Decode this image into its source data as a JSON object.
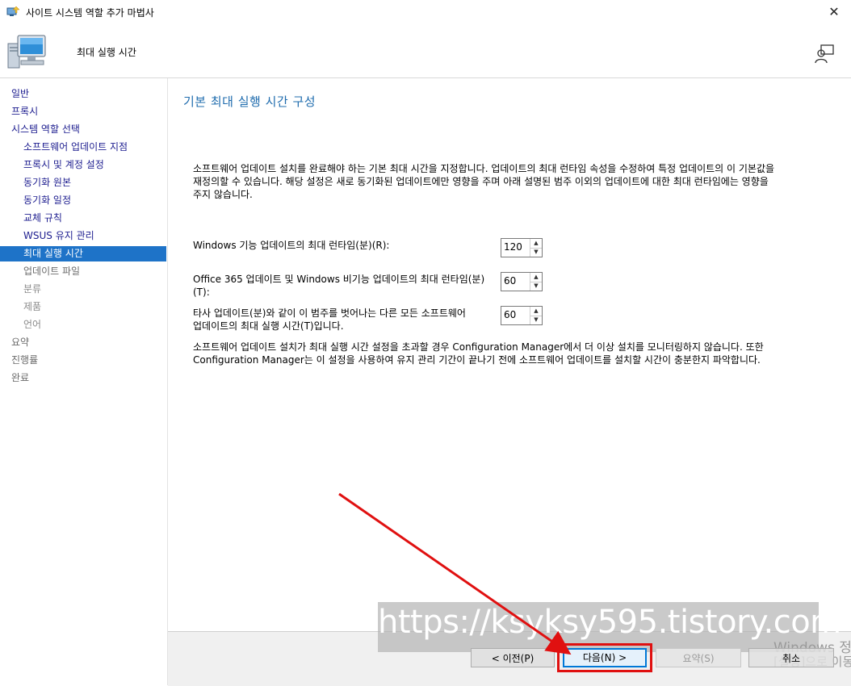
{
  "window": {
    "title": "사이트 시스템 역할 추가 마법사"
  },
  "header": {
    "subtitle": "최대 실행 시간"
  },
  "sidebar": {
    "items": [
      {
        "label": "일반",
        "level": 0,
        "state": "done"
      },
      {
        "label": "프록시",
        "level": 0,
        "state": "done"
      },
      {
        "label": "시스템 역할 선택",
        "level": 0,
        "state": "done"
      },
      {
        "label": "소프트웨어 업데이트 지점",
        "level": 1,
        "state": "done"
      },
      {
        "label": "프록시 및 계정 설정",
        "level": 1,
        "state": "done"
      },
      {
        "label": "동기화 원본",
        "level": 1,
        "state": "done"
      },
      {
        "label": "동기화 일정",
        "level": 1,
        "state": "done"
      },
      {
        "label": "교체 규칙",
        "level": 1,
        "state": "done"
      },
      {
        "label": "WSUS 유지 관리",
        "level": 1,
        "state": "done"
      },
      {
        "label": "최대 실행 시간",
        "level": 1,
        "state": "active"
      },
      {
        "label": "업데이트 파일",
        "level": 1,
        "state": "todo"
      },
      {
        "label": "분류",
        "level": 1,
        "state": "future"
      },
      {
        "label": "제품",
        "level": 1,
        "state": "future"
      },
      {
        "label": "언어",
        "level": 1,
        "state": "future"
      },
      {
        "label": "요약",
        "level": 0,
        "state": "todo"
      },
      {
        "label": "진행률",
        "level": 0,
        "state": "todo"
      },
      {
        "label": "완료",
        "level": 0,
        "state": "todo"
      }
    ]
  },
  "main": {
    "title": "기본 최대 실행 시간 구성",
    "description": [
      "소프트웨어 업데이트 설치를 완료해야 하는 기본 최대 시간을 지정합니다. 업데이트의 최대 런타임 속성을 수정하여 특정 업데이트의 이 기본값을",
      "재정의할 수 있습니다. 해당 설정은 새로 동기화된 업데이트에만 영향을 주며 아래 설명된 범주 이외의 업데이트에 대한 최대 런타임에는 영향을",
      "주지 않습니다."
    ],
    "fields": [
      {
        "label_lines": [
          "Windows 기능 업데이트의 최대 런타임(분)(R):"
        ],
        "value": "120"
      },
      {
        "label_lines": [
          "Office 365 업데이트 및 Windows 비기능 업데이트의 최대 런타임(분)",
          "(T):"
        ],
        "value": "60"
      },
      {
        "label_lines": [
          "타사 업데이트(분)와 같이 이 범주를 벗어나는 다른 모든 소프트웨어",
          "업데이트의 최대 실행 시간(T)입니다."
        ],
        "value": "60"
      }
    ],
    "note": [
      "소프트웨어 업데이트 설치가 최대 실행 시간 설정을 초과할 경우 Configuration Manager에서 더 이상 설치를 모니터링하지 않습니다. 또한",
      "Configuration Manager는 이 설정을 사용하여 유지 관리 기간이 끝나기 전에 소프트웨어 업데이트를 설치할 시간이 충분한지 파악합니다."
    ]
  },
  "footer": {
    "prev_label": "< 이전(P)",
    "next_label": "다음(N) >",
    "summary_label": "요약(S)",
    "cancel_label": "취소"
  },
  "overlay": {
    "watermark": "https://ksyksy595.tistory.com",
    "activation_line1": "Windows 정",
    "activation_line2": "[설정]으로 이동"
  },
  "colors": {
    "accent": "#1e73c8",
    "title_blue": "#1f6cae",
    "annotation_red": "#e01010"
  }
}
